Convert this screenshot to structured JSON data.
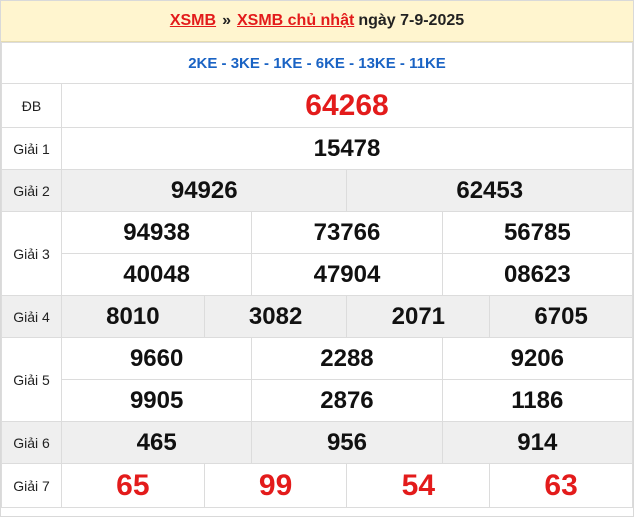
{
  "header": {
    "link1": "XSMB",
    "separator": "»",
    "link2": "XSMB chủ nhật",
    "date": "ngày 7-9-2025"
  },
  "codes": "2KE - 3KE - 1KE - 6KE - 13KE - 11KE",
  "prizes": {
    "db": {
      "label": "ĐB",
      "numbers": [
        "64268"
      ]
    },
    "g1": {
      "label": "Giải 1",
      "numbers": [
        "15478"
      ]
    },
    "g2": {
      "label": "Giải 2",
      "numbers": [
        "94926",
        "62453"
      ]
    },
    "g3": {
      "label": "Giải 3",
      "numbers": [
        "94938",
        "73766",
        "56785",
        "40048",
        "47904",
        "08623"
      ]
    },
    "g4": {
      "label": "Giải 4",
      "numbers": [
        "8010",
        "3082",
        "2071",
        "6705"
      ]
    },
    "g5": {
      "label": "Giải 5",
      "numbers": [
        "9660",
        "2288",
        "9206",
        "9905",
        "2876",
        "1186"
      ]
    },
    "g6": {
      "label": "Giải 6",
      "numbers": [
        "465",
        "956",
        "914"
      ]
    },
    "g7": {
      "label": "Giải 7",
      "numbers": [
        "65",
        "99",
        "54",
        "63"
      ]
    }
  },
  "colors": {
    "accent_red": "#e31b1b",
    "code_blue": "#1a63c4",
    "header_bg": "#fff5cf",
    "row_shade": "#efefef"
  }
}
